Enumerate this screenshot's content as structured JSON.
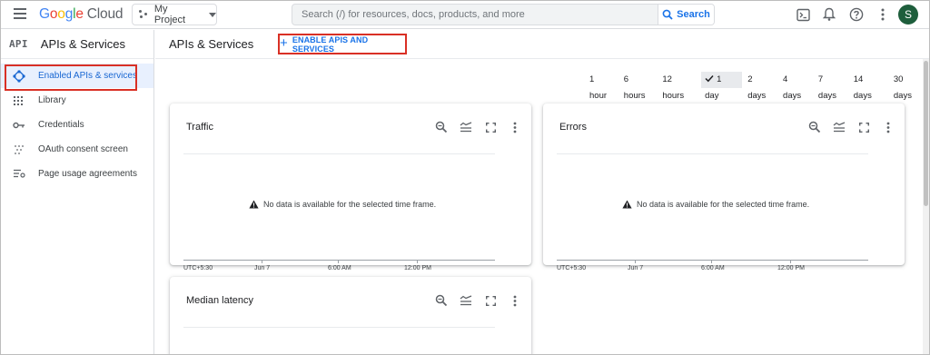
{
  "header": {
    "logo_google": "Google",
    "logo_cloud": "Cloud",
    "project_label": "My Project",
    "search_placeholder": "Search (/) for resources, docs, products, and more",
    "search_button": "Search",
    "avatar_initial": "S",
    "avatar_color": "#1e5e3c"
  },
  "sidebar": {
    "badge": "API",
    "title": "APIs & Services",
    "items": [
      {
        "label": "Enabled APIs & services",
        "icon": "api-diamond-icon",
        "active": true
      },
      {
        "label": "Library",
        "icon": "library-grid-icon"
      },
      {
        "label": "Credentials",
        "icon": "key-icon"
      },
      {
        "label": "OAuth consent screen",
        "icon": "oauth-dots-icon"
      },
      {
        "label": "Page usage agreements",
        "icon": "settings-list-icon"
      }
    ]
  },
  "main": {
    "title": "APIs & Services",
    "enable_button": "ENABLE APIS AND SERVICES",
    "time_ranges": [
      "1 hour",
      "6 hours",
      "12 hours",
      "1 day",
      "2 days",
      "4 days",
      "7 days",
      "14 days",
      "30 days"
    ],
    "selected_range": "1 day",
    "cards": [
      {
        "title": "Traffic",
        "message": "No data is available for the selected time frame.",
        "axis": [
          "UTC+5:30",
          "Jun 7",
          "6:00 AM",
          "12:00 PM"
        ]
      },
      {
        "title": "Errors",
        "message": "No data is available for the selected time frame.",
        "axis": [
          "UTC+5:30",
          "Jun 7",
          "6:00 AM",
          "12:00 PM"
        ]
      },
      {
        "title": "Median latency"
      }
    ]
  },
  "colors": {
    "accent": "#1a73e8",
    "highlight_border": "#d93025",
    "active_nav_bg": "#e8f0fe"
  }
}
